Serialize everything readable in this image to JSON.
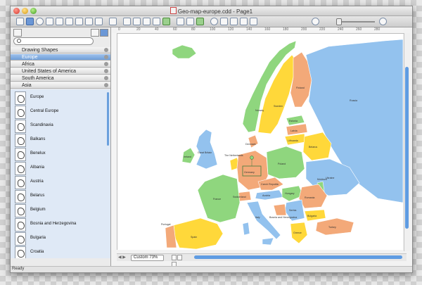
{
  "window": {
    "title": "Geo-map-europe.cdd - Page1"
  },
  "colors": {
    "land_green": "#8fd67e",
    "land_orange": "#f3a979",
    "land_yellow": "#ffd83a",
    "land_blue": "#93c2ee",
    "accent_blue": "#5f9ce2"
  },
  "sidebar": {
    "libraries": [
      {
        "label": "Drawing Shapes",
        "active": false
      },
      {
        "label": "Europe",
        "active": true
      },
      {
        "label": "Africa",
        "active": false
      },
      {
        "label": "United States of America",
        "active": false
      },
      {
        "label": "South America",
        "active": false
      },
      {
        "label": "Asia",
        "active": false
      }
    ],
    "shapes": [
      "Europe",
      "Central Europe",
      "Scandinavia",
      "Balkans",
      "Benelux",
      "Albania",
      "Austria",
      "Belarus",
      "Belgium",
      "Bosnia and Herzegovina",
      "Bulgaria",
      "Croatia"
    ]
  },
  "canvas": {
    "ruler_numbers": [
      "0",
      "20",
      "40",
      "60",
      "80",
      "100",
      "120",
      "140",
      "160",
      "180",
      "200",
      "220",
      "240",
      "260",
      "280"
    ],
    "zoom_label": "Custom 73%"
  },
  "map": {
    "labels": {
      "sweden": "Sweden",
      "finland": "Finland",
      "norway": "Norway",
      "estonia": "Estonia",
      "latvia": "Latvia",
      "lithuania": "Lithuania",
      "russia": "Russia",
      "belarus": "Belarus",
      "ukraine": "Ukraine",
      "poland": "Poland",
      "germany": "Germany",
      "netherlands": "The Netherlands",
      "great_britain": "Great Britain",
      "ireland": "Ireland",
      "france": "France",
      "switzerland": "Switzerland",
      "czech": "Czech Republic",
      "austria": "Austria",
      "hungary": "Hungary",
      "romania": "Romania",
      "bulgaria": "Bulgaria",
      "serbia": "Serbia",
      "italy": "Italy",
      "spain": "Spain",
      "portugal": "Portugal",
      "greece": "Greece",
      "turkey": "Turkey",
      "moldova": "Moldova",
      "denmark": "Denmark",
      "bosnia": "Bosnia and Herzegovina"
    }
  },
  "status": {
    "text": "Ready"
  }
}
